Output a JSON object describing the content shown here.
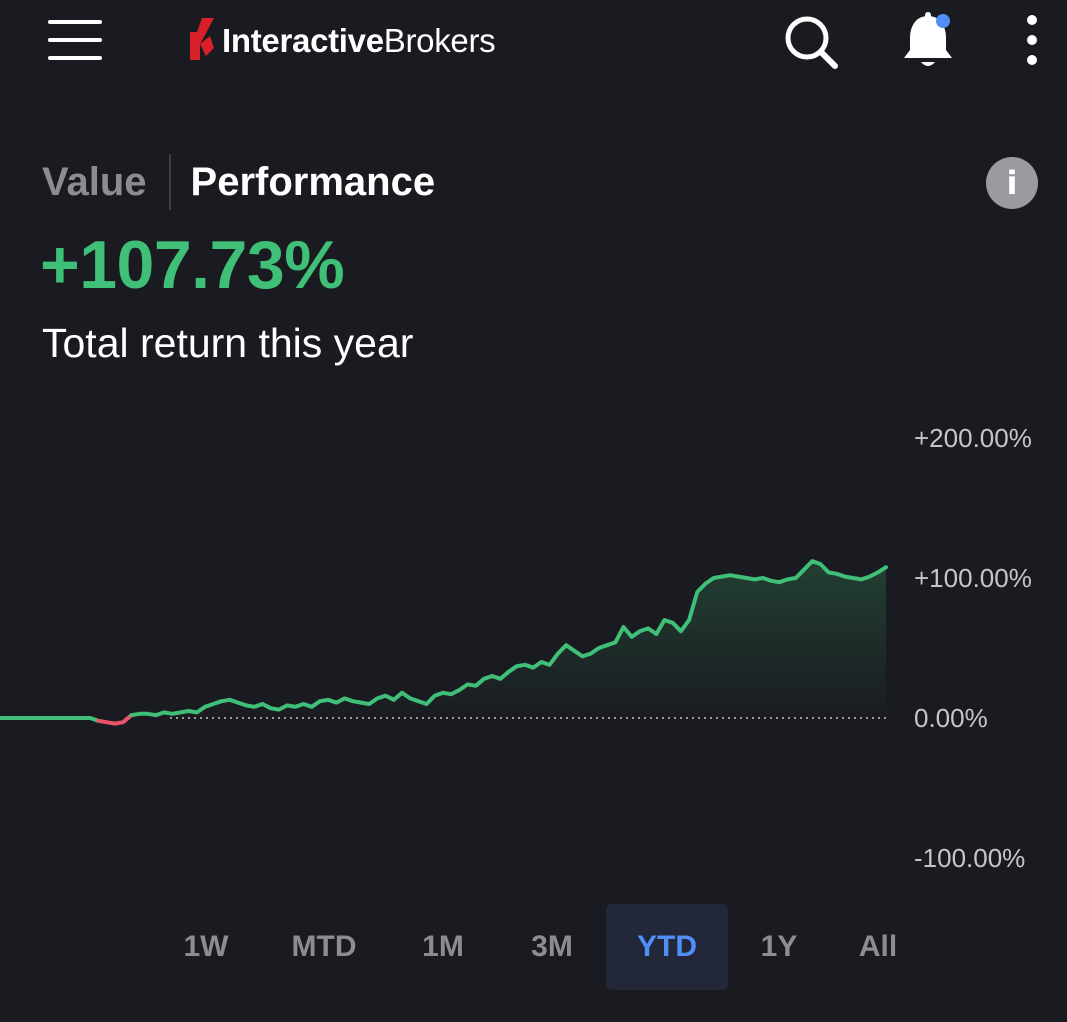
{
  "header": {
    "brand_bold": "Interactive",
    "brand_light": "Brokers",
    "icons": [
      "menu-icon",
      "search-icon",
      "bell-icon",
      "more-vertical-icon"
    ],
    "notification_dot_color": "#4f8ff7"
  },
  "toggle": {
    "value_label": "Value",
    "performance_label": "Performance",
    "selected": "Performance"
  },
  "summary": {
    "return_value": "+107.73%",
    "return_caption": "Total return this year",
    "positive_color": "#3fbf77",
    "negative_color": "#e8546a"
  },
  "ranges": {
    "items": [
      "1W",
      "MTD",
      "1M",
      "3M",
      "YTD",
      "1Y",
      "All"
    ],
    "selected": "YTD"
  },
  "chart_data": {
    "type": "line",
    "ylim": [
      -100,
      200
    ],
    "y_ticks": [
      "+200.00%",
      "+100.00%",
      "0.00%",
      "-100.00%"
    ],
    "baseline": 0,
    "grid": false,
    "x": [],
    "series": [
      {
        "values": [
          0,
          0,
          0,
          0,
          0,
          0,
          0,
          0,
          0,
          0,
          0,
          0,
          -2,
          -3,
          -4,
          -3,
          2,
          3,
          3,
          2,
          4,
          3,
          4,
          5,
          4,
          8,
          10,
          12,
          13,
          11,
          9,
          8,
          10,
          7,
          6,
          9,
          8,
          10,
          8,
          12,
          13,
          11,
          14,
          12,
          11,
          10,
          14,
          16,
          13,
          18,
          14,
          12,
          10,
          16,
          18,
          17,
          20,
          24,
          23,
          28,
          30,
          28,
          33,
          37,
          38,
          36,
          40,
          38,
          46,
          52,
          48,
          44,
          46,
          50,
          52,
          54,
          65,
          58,
          62,
          64,
          60,
          70,
          68,
          62,
          70,
          90,
          96,
          100,
          101,
          102,
          101,
          100,
          99,
          100,
          98,
          97,
          99,
          100,
          106,
          112,
          110,
          104,
          103,
          101,
          100,
          99,
          101,
          104,
          107.73
        ]
      }
    ]
  }
}
